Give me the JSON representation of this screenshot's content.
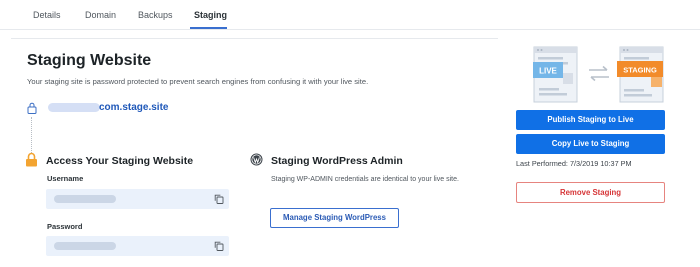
{
  "tabs": [
    {
      "label": "Details"
    },
    {
      "label": "Domain"
    },
    {
      "label": "Backups"
    },
    {
      "label": "Staging"
    }
  ],
  "staging": {
    "title": "Staging Website",
    "description": "Your staging site is password protected to prevent search engines from confusing it with your live site.",
    "url_suffix": "com.stage.site"
  },
  "access": {
    "title": "Access Your Staging Website",
    "username_label": "Username",
    "password_label": "Password"
  },
  "wp_admin": {
    "title": "Staging WordPress Admin",
    "description": "Staging WP-ADMIN credentials are identical to your live site.",
    "button_label": "Manage Staging WordPress"
  },
  "illustration": {
    "live_label": "LIVE",
    "staging_label": "STAGING"
  },
  "actions": {
    "publish_label": "Publish Staging to Live",
    "copy_label": "Copy Live to Staging",
    "last_performed": "Last Performed: 7/3/2019 10:37 PM",
    "remove_label": "Remove Staging"
  },
  "colors": {
    "accent_blue": "#1070e6",
    "link_blue": "#1f58b9",
    "lock_orange": "#f3a431",
    "danger_red": "#d63638",
    "field_bg": "#eaf1fb",
    "live_blue": "#74b6e8",
    "staging_orange": "#f28b2a"
  }
}
